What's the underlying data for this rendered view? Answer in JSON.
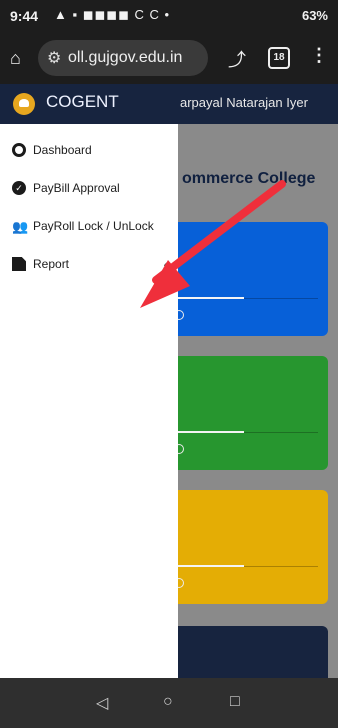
{
  "statusbar": {
    "time": "9:44",
    "indicators": "▲ ▪ ◼◼◼◼ C C •",
    "battery_label": "63%"
  },
  "browser": {
    "url": "oll.gujgov.edu.in",
    "tab_count": "18"
  },
  "app": {
    "brand": "COGENT",
    "user_name": "arpayal Natarajan Iyer",
    "college_title": "ommerce College",
    "sidebar": {
      "items": [
        {
          "label": "Dashboard",
          "icon": "tachometer-icon"
        },
        {
          "label": "PayBill Approval",
          "icon": "check-circle-icon"
        },
        {
          "label": "PayRoll Lock / UnLock",
          "icon": "user-plus-icon"
        },
        {
          "label": "Report",
          "icon": "file-icon"
        }
      ]
    },
    "cards": [
      {
        "color": "#0760d8"
      },
      {
        "color": "#27962f"
      },
      {
        "color": "#e4ad05"
      },
      {
        "color": "#17243f"
      }
    ]
  },
  "annotation": {
    "arrow_color": "#ef2f3b"
  }
}
